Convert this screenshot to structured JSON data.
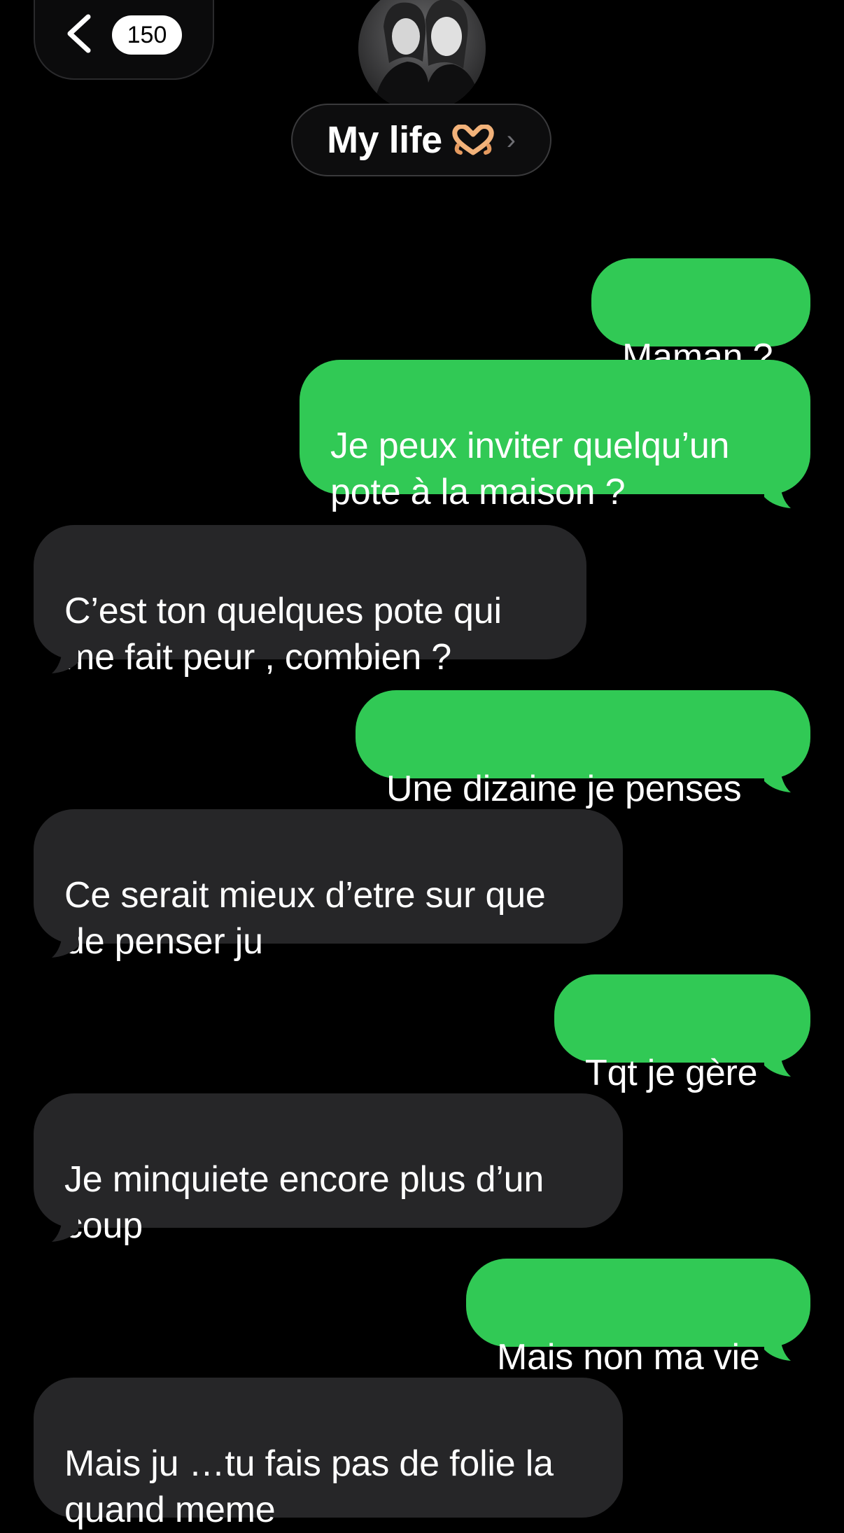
{
  "header": {
    "unread_count": "150",
    "contact_name": "My life",
    "contact_emoji": "heart-hands-icon",
    "chevron_glyph": "›"
  },
  "colors": {
    "background": "#000000",
    "sent_bubble": "#31c955",
    "received_bubble": "#262628",
    "text": "#ffffff"
  },
  "messages": [
    {
      "direction": "sent",
      "text": "Maman ?"
    },
    {
      "direction": "sent",
      "text": "Je peux inviter quelqu’un\npote à la maison ?"
    },
    {
      "direction": "received",
      "text": "C’est ton quelques pote qui\nme fait peur , combien ?"
    },
    {
      "direction": "sent",
      "text": "Une dizaine je penses"
    },
    {
      "direction": "received",
      "text": "Ce serait mieux d’etre sur que\nde penser ju"
    },
    {
      "direction": "sent",
      "text": "Tqt je gère"
    },
    {
      "direction": "received",
      "text": "Je minquiete encore plus d’un\ncoup"
    },
    {
      "direction": "sent",
      "text": "Mais non ma vie"
    },
    {
      "direction": "received",
      "text": "Mais ju …tu fais pas de folie la\nquand meme"
    }
  ]
}
